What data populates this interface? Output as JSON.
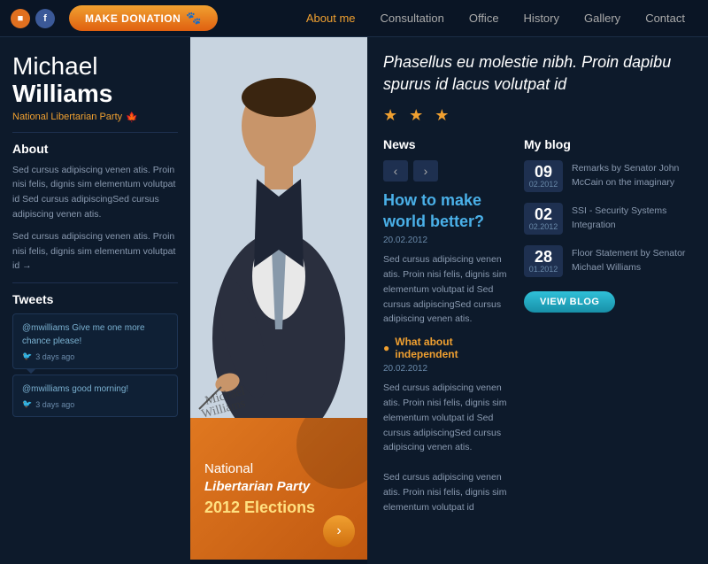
{
  "header": {
    "donate_label": "MAKE DONATION",
    "nav": [
      {
        "label": "About me",
        "active": true
      },
      {
        "label": "Consultation",
        "active": false
      },
      {
        "label": "Office",
        "active": false
      },
      {
        "label": "History",
        "active": false
      },
      {
        "label": "Gallery",
        "active": false
      },
      {
        "label": "Contact",
        "active": false
      }
    ]
  },
  "sidebar": {
    "first_name": "Michael",
    "last_name": "Williams",
    "party": "National Libertarian Party",
    "about_title": "About",
    "about_p1": "Sed cursus adipiscing venen atis. Proin nisi felis, dignis sim elementum volutpat id Sed cursus adipiscingSed cursus adipiscing venen atis.",
    "about_p2": "Sed cursus adipiscing venen atis. Proin nisi felis, dignis sim elementum volutpat id →",
    "tweets_title": "Tweets",
    "tweets": [
      {
        "text": "@mwilliams Give me one more chance please!",
        "time": "3 days ago"
      },
      {
        "text": "@mwilliams good morning!",
        "time": "3 days ago"
      }
    ]
  },
  "nlp_card": {
    "line1": "National",
    "line2": "Libertarian Party",
    "year": "2012 Elections",
    "arrow": "›"
  },
  "content": {
    "hero_quote": "Phasellus eu molestie nibh. Proin dapibu spurus id lacus volutpat id",
    "stars": "★ ★ ★",
    "news": {
      "title": "News",
      "article1": {
        "title": "How to make world better?",
        "date": "20.02.2012",
        "body": "Sed cursus adipiscing venen atis. Proin nisi felis, dignis sim elementum volutpat id Sed cursus adipiscingSed cursus adipiscing venen atis."
      },
      "article2": {
        "title": "What about independent",
        "date": "20.02.2012",
        "body": "Sed cursus adipiscing venen atis. Proin nisi felis, dignis sim elementum volutpat id Sed cursus adipiscingSed cursus adipiscing venen atis.\n\nSed cursus adipiscing venen atis. Proin nisi felis, dignis sim elementum volutpat id"
      }
    },
    "blog": {
      "title": "My blog",
      "entries": [
        {
          "day": "09",
          "month": "02.2012",
          "text": "Remarks by Senator John McCain on the imaginary"
        },
        {
          "day": "02",
          "month": "02.2012",
          "text": "SSI - Security Systems Integration"
        },
        {
          "day": "28",
          "month": "01.2012",
          "text": "Floor Statement by Senator Michael Williams"
        }
      ],
      "view_label": "VIEW BLOG"
    }
  }
}
